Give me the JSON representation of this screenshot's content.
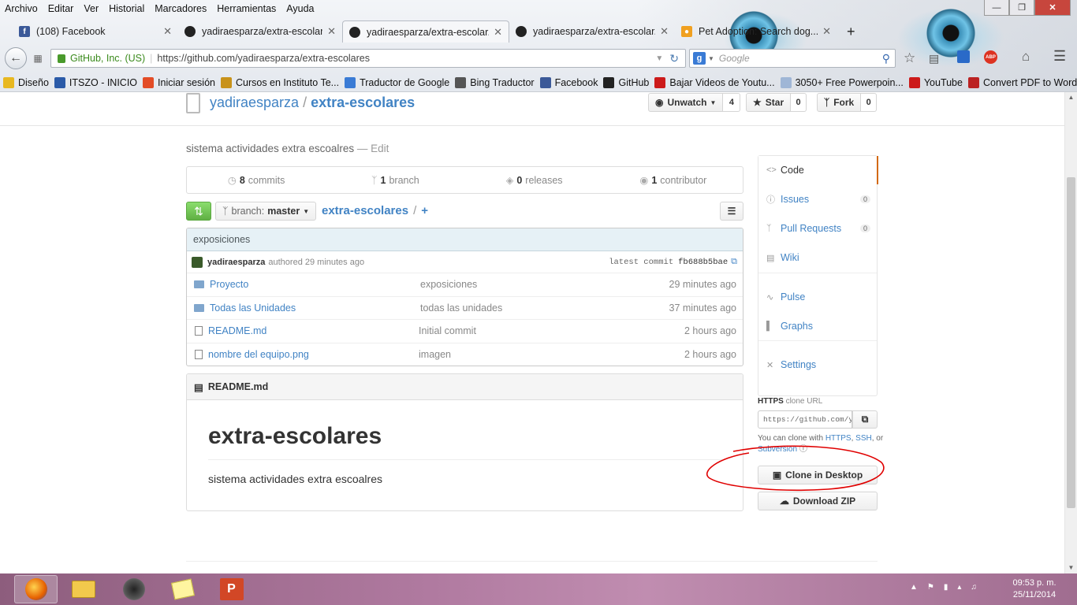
{
  "menu": [
    "Archivo",
    "Editar",
    "Ver",
    "Historial",
    "Marcadores",
    "Herramientas",
    "Ayuda"
  ],
  "tabs": [
    {
      "title": "(108) Facebook",
      "icon": "facebook-icon"
    },
    {
      "title": "yadiraesparza/extra-escolar...",
      "icon": "github-icon"
    },
    {
      "title": "yadiraesparza/extra-escolar...",
      "icon": "github-icon"
    },
    {
      "title": "yadiraesparza/extra-escolar...",
      "icon": "github-icon"
    },
    {
      "title": "Pet Adoption: Search dog...",
      "icon": "paw-icon"
    }
  ],
  "new_tab": "+",
  "url": {
    "identity": "GitHub, Inc. (US)",
    "address": "https://github.com/yadiraesparza/extra-escolares"
  },
  "search": {
    "engine": "g",
    "placeholder": "Google"
  },
  "bookmarks": [
    {
      "label": "Diseño",
      "icon": "folder-icon",
      "color": "#e8b820"
    },
    {
      "label": "ITSZO - INICIO",
      "icon": "monitor-icon",
      "color": "#2a5aa8"
    },
    {
      "label": "Iniciar sesión",
      "icon": "windows-icon",
      "color": "#e34c26"
    },
    {
      "label": "Cursos en Instituto Te...",
      "icon": "school-icon",
      "color": "#c8921a"
    },
    {
      "label": "Traductor de Google",
      "icon": "translate-icon",
      "color": "#3a7bd5"
    },
    {
      "label": "Bing Traductor",
      "icon": "bing-icon",
      "color": "#555"
    },
    {
      "label": "Facebook",
      "icon": "facebook-icon",
      "color": "#3b5998"
    },
    {
      "label": "GitHub",
      "icon": "github-icon",
      "color": "#222"
    },
    {
      "label": "Bajar Videos de Youtu...",
      "icon": "youtube-icon",
      "color": "#cc1a1a"
    },
    {
      "label": "3050+ Free Powerpoin...",
      "icon": "page-icon",
      "color": "#9fb6d6"
    },
    {
      "label": "YouTube",
      "icon": "youtube-icon",
      "color": "#cc1a1a"
    },
    {
      "label": "Convert PDF to Word ...",
      "icon": "pdf-icon",
      "color": "#b22"
    }
  ],
  "repo": {
    "owner": "yadiraesparza",
    "sep": "/",
    "name": "extra-escolares",
    "watch": {
      "label": "Unwatch",
      "count": "4"
    },
    "star": {
      "label": "Star",
      "count": "0"
    },
    "fork": {
      "label": "Fork",
      "count": "0"
    },
    "description": "sistema actividades extra escoalres",
    "edit": "Edit",
    "stats": [
      {
        "num": "8",
        "label": "commits"
      },
      {
        "num": "1",
        "label": "branch"
      },
      {
        "num": "0",
        "label": "releases"
      },
      {
        "num": "1",
        "label": "contributor"
      }
    ],
    "branch": {
      "prefix": "branch:",
      "name": "master"
    },
    "breadcrumb": {
      "repo": "extra-escolares",
      "sep": "/",
      "add": "+"
    },
    "commit": {
      "message": "exposiciones",
      "author": "yadiraesparza",
      "meta": "authored 29 minutes ago",
      "latest_label": "latest commit",
      "sha": "fb688b5bae"
    },
    "files": [
      {
        "name": "Proyecto",
        "type": "folder",
        "message": "exposiciones",
        "age": "29 minutes ago"
      },
      {
        "name": "Todas las Unidades",
        "type": "folder",
        "message": "todas las unidades",
        "age": "37 minutes ago"
      },
      {
        "name": "README.md",
        "type": "file",
        "message": "Initial commit",
        "age": "2 hours ago"
      },
      {
        "name": "nombre del equipo.png",
        "type": "file",
        "message": "imagen",
        "age": "2 hours ago"
      }
    ],
    "readme": {
      "header": "README.md",
      "title": "extra-escolares",
      "body": "sistema actividades extra escoalres"
    }
  },
  "sidebar": {
    "items": [
      {
        "label": "Code",
        "count": ""
      },
      {
        "label": "Issues",
        "count": "0"
      },
      {
        "label": "Pull Requests",
        "count": "0"
      },
      {
        "label": "Wiki",
        "count": ""
      },
      {
        "label": "Pulse",
        "count": ""
      },
      {
        "label": "Graphs",
        "count": ""
      },
      {
        "label": "Settings",
        "count": ""
      }
    ],
    "clone": {
      "protocol": "HTTPS",
      "label": "clone URL",
      "url": "https://github.com/yadiraesparza/extra-escolares.git",
      "help_prefix": "You can clone with",
      "https": "HTTPS",
      "ssh": "SSH",
      "or": ", or",
      "subversion": "Subversion",
      "desktop": "Clone in Desktop",
      "zip": "Download ZIP"
    }
  },
  "taskbar": {
    "time": "09:53 p. m.",
    "date": "25/11/2014"
  },
  "colors": {
    "link": "#4183c4",
    "annotation": "#e00000",
    "taskbar": "#b07aa0"
  }
}
